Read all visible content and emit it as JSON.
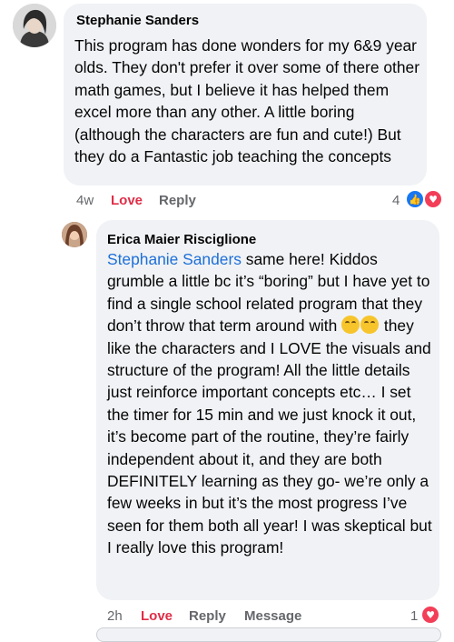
{
  "comments": [
    {
      "author": "Stephanie Sanders",
      "text": "This program has done wonders for my 6&9 year olds. They don't prefer it over some of there other math games, but I believe it has helped them excel more than any other. A little boring (although the characters are fun and cute!) But they do a Fantastic job teaching the concepts",
      "time": "4w",
      "love_label": "Love",
      "reply_label": "Reply",
      "reaction_count": "4",
      "reactions": [
        "like-icon",
        "heart-icon"
      ]
    },
    {
      "author": "Erica Maier Risciglione",
      "mention": "Stephanie Sanders",
      "text_part1": " same here! Kiddos grumble a little bc it’s “boring” but I have yet to find a single school related program that they don’t throw that term around with ",
      "emoji": "😂😂",
      "text_part2": " they like the characters and I LOVE the visuals and structure of the program! All the little details just reinforce important concepts etc… I set the timer for 15 min and we just knock it out, it’s become part of the routine, they’re fairly independent about it, and they are both DEFINITELY learning as they go- we’re only a few weeks in but it’s the most progress I’ve seen for them both all year! I was skeptical but I really love this program!",
      "time": "2h",
      "love_label": "Love",
      "reply_label": "Reply",
      "message_label": "Message",
      "reaction_count": "1",
      "reactions": [
        "heart-icon"
      ]
    }
  ],
  "colors": {
    "bubble": "#f0f2f5",
    "mention": "#1d6fd8",
    "love": "#e02d47",
    "meta": "#65676b",
    "like": "#1877f2",
    "heart": "#f33e58"
  }
}
